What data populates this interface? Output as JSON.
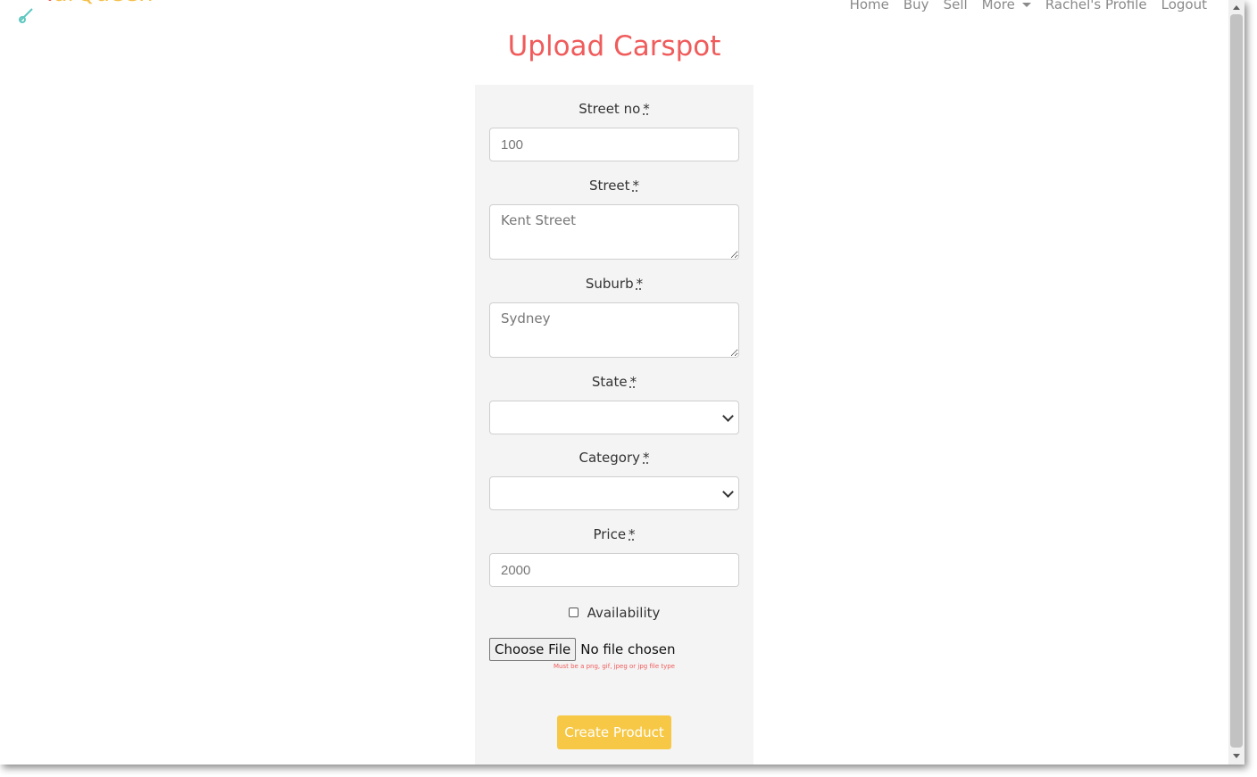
{
  "navbar": {
    "logo_first": "T",
    "logo_rest": "arQueen",
    "links": [
      "Home",
      "Buy",
      "Sell",
      "More",
      "Rachel's Profile",
      "Logout"
    ]
  },
  "page": {
    "title": "Upload Carspot"
  },
  "form": {
    "required_mark": "*",
    "street_no": {
      "label": "Street no",
      "placeholder": "100"
    },
    "street": {
      "label": "Street",
      "placeholder": "Kent Street"
    },
    "suburb": {
      "label": "Suburb",
      "placeholder": "Sydney"
    },
    "state": {
      "label": "State",
      "value": ""
    },
    "category": {
      "label": "Category",
      "value": ""
    },
    "price": {
      "label": "Price",
      "placeholder": "2000"
    },
    "availability": {
      "label": "Availability",
      "checked": false
    },
    "file": {
      "button_label": "Choose File",
      "status": "No file chosen",
      "hint": "Must be a png, gif, jpeg or jpg file type"
    },
    "submit_label": "Create Product"
  },
  "colors": {
    "accent": "#f05b5b",
    "button": "#f7c846",
    "panel": "#f4f4f4"
  }
}
